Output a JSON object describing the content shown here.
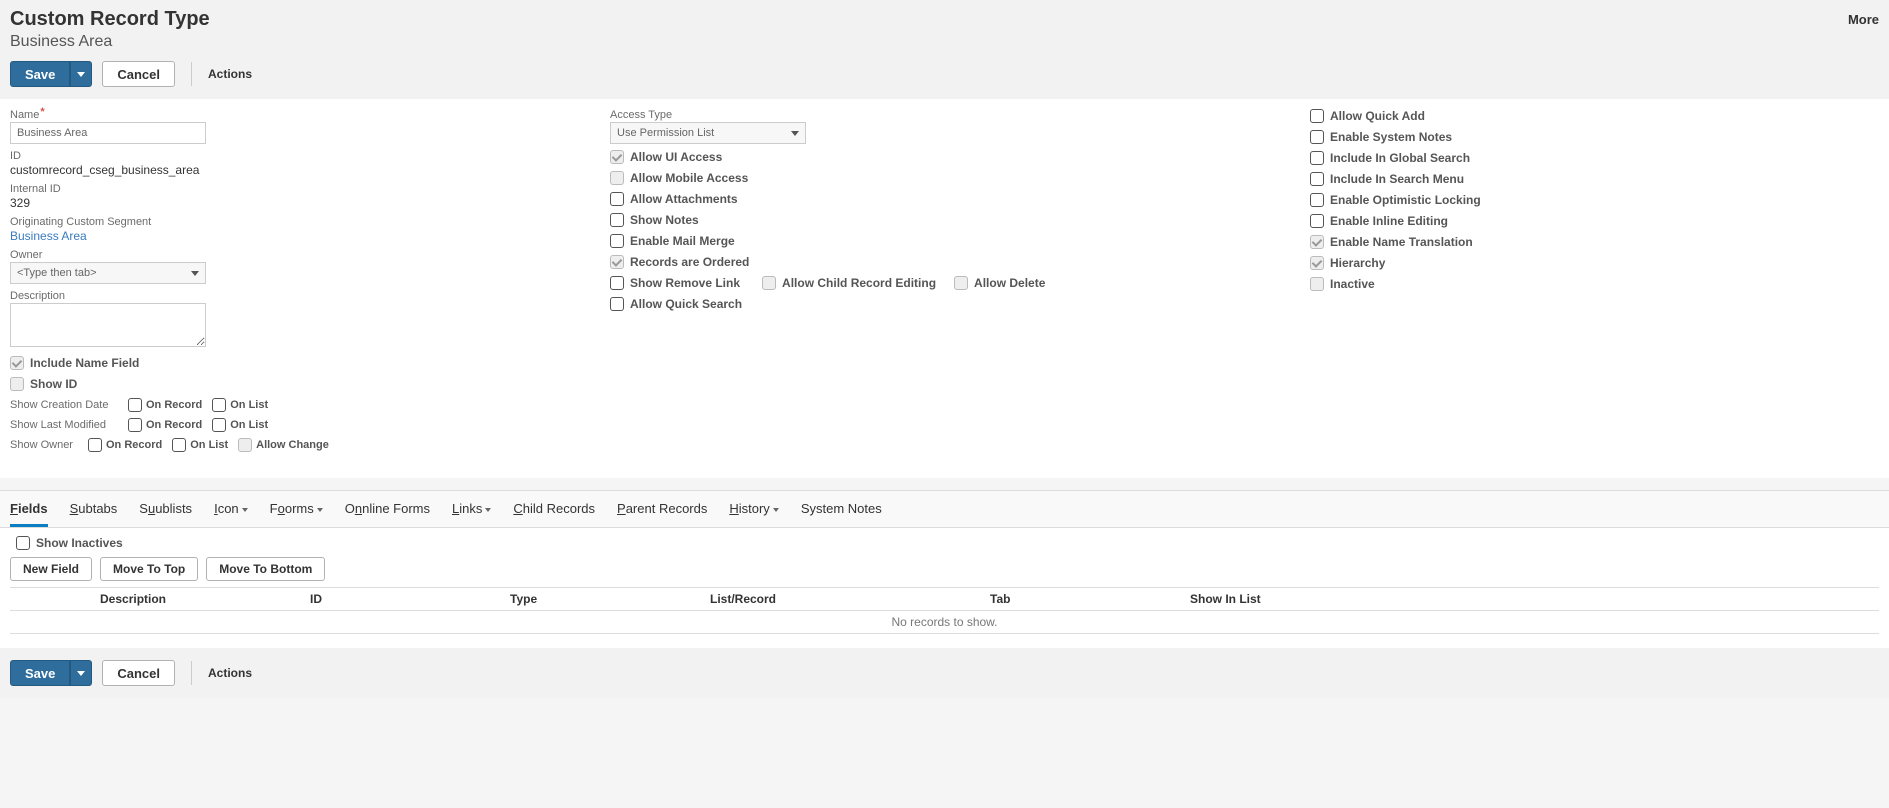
{
  "header": {
    "title": "Custom Record Type",
    "subtitle": "Business Area",
    "more": "More"
  },
  "buttons": {
    "save": "Save",
    "cancel": "Cancel",
    "actions": "Actions",
    "new_field": "New Field",
    "move_top": "Move To Top",
    "move_bottom": "Move To Bottom"
  },
  "col1": {
    "name_label": "Name",
    "name_value": "Business Area",
    "id_label": "ID",
    "id_value": "customrecord_cseg_business_area",
    "internal_id_label": "Internal ID",
    "internal_id_value": "329",
    "origin_label": "Originating Custom Segment",
    "origin_value": "Business Area",
    "owner_label": "Owner",
    "owner_placeholder": "<Type then tab>",
    "desc_label": "Description",
    "include_name_field": "Include Name Field",
    "show_id": "Show ID",
    "show_creation": "Show Creation Date",
    "show_modified": "Show Last Modified",
    "show_owner": "Show Owner",
    "on_record": "On Record",
    "on_list": "On List",
    "allow_change": "Allow Change"
  },
  "col2": {
    "access_type_label": "Access Type",
    "access_type_value": "Use Permission List",
    "allow_ui": "Allow UI Access",
    "allow_mobile": "Allow Mobile Access",
    "allow_attachments": "Allow Attachments",
    "show_notes": "Show Notes",
    "enable_mail_merge": "Enable Mail Merge",
    "records_ordered": "Records are Ordered",
    "show_remove_link": "Show Remove Link",
    "allow_child_edit": "Allow Child Record Editing",
    "allow_delete": "Allow Delete",
    "allow_quick_search": "Allow Quick Search"
  },
  "col3": {
    "allow_quick_add": "Allow Quick Add",
    "enable_system_notes": "Enable System Notes",
    "include_global_search": "Include In Global Search",
    "include_search_menu": "Include In Search Menu",
    "enable_optimistic_locking": "Enable Optimistic Locking",
    "enable_inline_editing": "Enable Inline Editing",
    "enable_name_translation": "Enable Name Translation",
    "hierarchy": "Hierarchy",
    "inactive": "Inactive"
  },
  "tabs": {
    "fields": "ields",
    "subtabs": "ubtabs",
    "sublists": "ublists",
    "icon": "con",
    "forms": "orms",
    "online_forms": "nline Forms",
    "links": "inks",
    "child_records": "hild Records",
    "parent_records": "arent Records",
    "history": "istory",
    "system_notes": "System Notes",
    "raw": {
      "fields": "Fields",
      "subtabs": "Subtabs",
      "sublists": "Sublists",
      "icon": "Icon",
      "forms": "Forms",
      "online_forms": "Online Forms",
      "links": "Links",
      "child_records": "Child Records",
      "parent_records": "Parent Records",
      "history": "History"
    }
  },
  "fields_tab": {
    "show_inactives": "Show Inactives",
    "columns": {
      "description": "Description",
      "id": "ID",
      "type": "Type",
      "list_record": "List/Record",
      "tab": "Tab",
      "show_in_list": "Show In List"
    },
    "no_records": "No records to show."
  }
}
